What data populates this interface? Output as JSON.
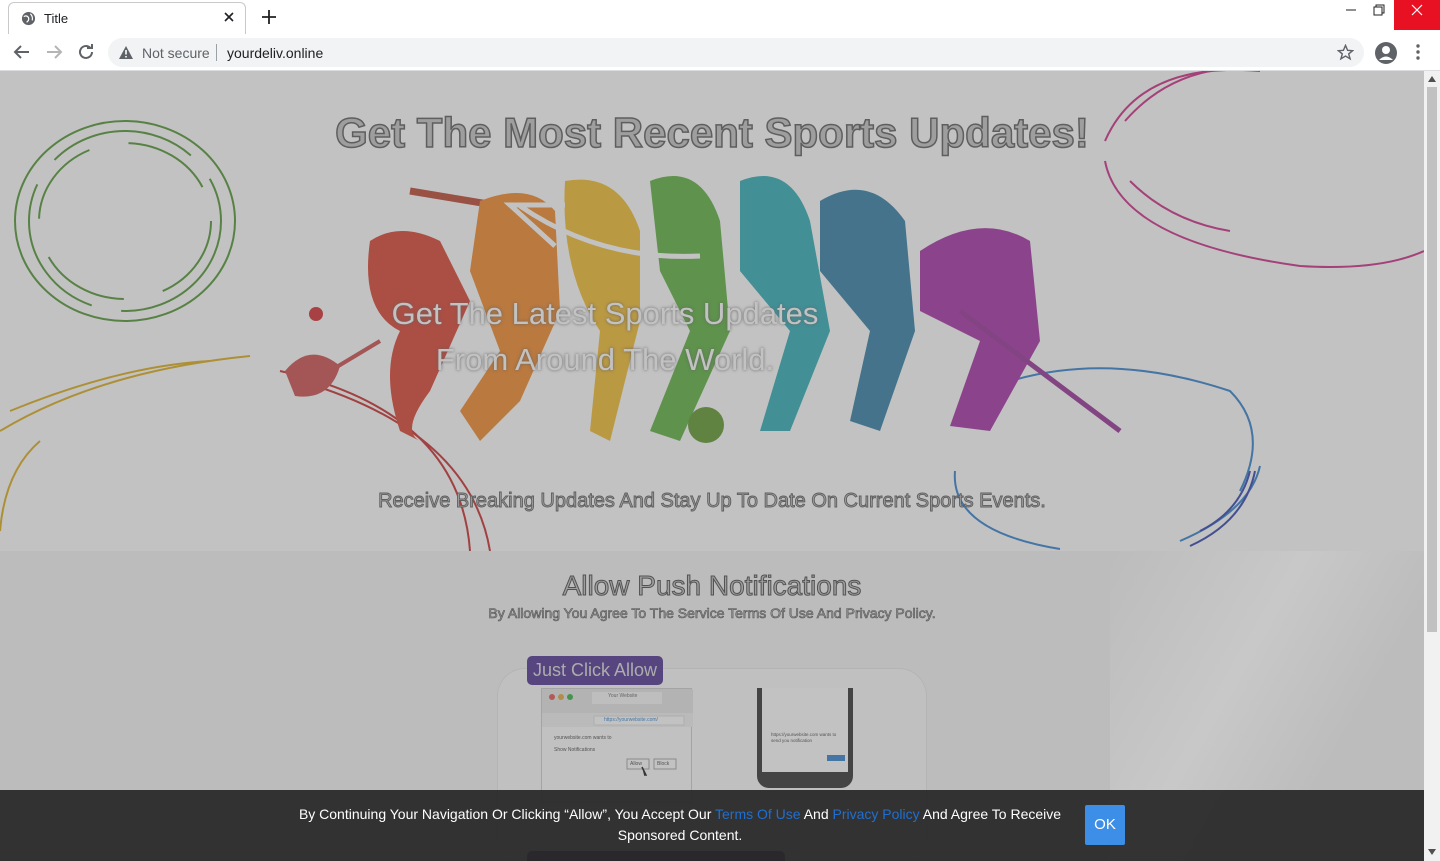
{
  "browser": {
    "tab_title": "Title",
    "not_secure": "Not secure",
    "url": "yourdeliv.online"
  },
  "hero": {
    "title": "Get The Most Recent Sports Updates!",
    "text_line1": "Get The Latest Sports Updates",
    "text_line2": "From Around The World.",
    "subtitle": "Receive Breaking Updates And Stay Up To Date On Current Sports Events."
  },
  "allow": {
    "title": "Allow Push Notifications",
    "subtitle": "By Allowing You Agree To The Service Terms Of Use And Privacy Policy.",
    "badge": "Just Click Allow",
    "desktop": {
      "tab_label": "Your Website",
      "url": "https://yourwebsite.com/",
      "prompt": "yourwebsite.com wants to",
      "option": "Show Notifications",
      "allow": "Allow",
      "block": "Block"
    },
    "phone": {
      "prompt": "https://yourwebsite.com wants to send you notification"
    }
  },
  "consent": {
    "text_before": "By Continuing Your Navigation Or Clicking “Allow”, You Accept Our ",
    "terms": "Terms Of Use",
    "and": " And ",
    "privacy": "Privacy Policy",
    "text_after": " And Agree To Receive Sponsored Content.",
    "ok": "OK"
  },
  "colors": {
    "overlay": "#787878",
    "badge": "#3b1d86",
    "ok_button": "#3d8ee6",
    "link": "#1f6fd1"
  }
}
